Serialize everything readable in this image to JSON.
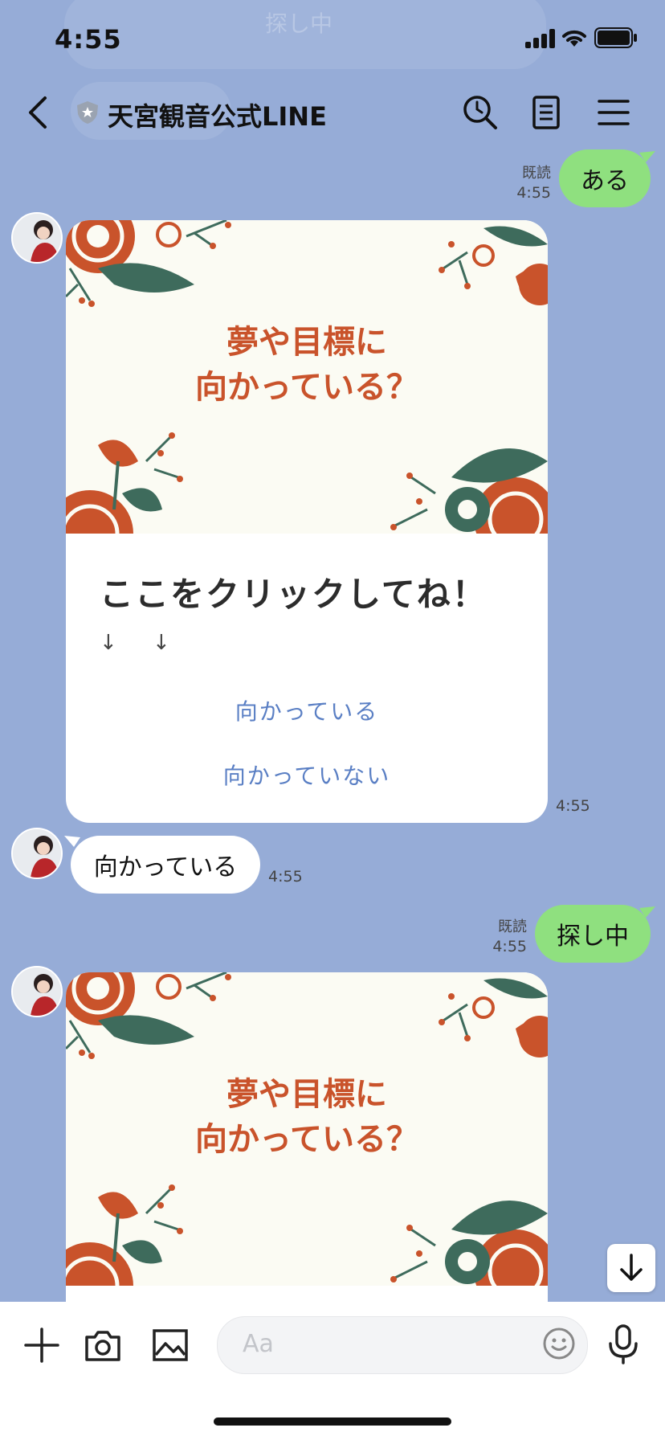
{
  "status_bar": {
    "time": "4:55"
  },
  "ghost_message": {
    "text": "探し中"
  },
  "header": {
    "title": "天宮観音公式LINE"
  },
  "messages": {
    "out1": {
      "read": "既読",
      "time": "4:55",
      "text": "ある"
    },
    "card1": {
      "image_line1": "夢や目標に",
      "image_line2": "向かっている？",
      "heading": "ここをクリックしてね！",
      "arrows": "↓ ↓",
      "option1": "向かっている",
      "option2": "向かっていない",
      "time": "4:55"
    },
    "in1": {
      "text": "向かっている",
      "time": "4:55"
    },
    "out2": {
      "read": "既読",
      "time": "4:55",
      "text": "探し中"
    },
    "card2": {
      "image_line1": "夢や目標に",
      "image_line2": "向かっている？"
    }
  },
  "input": {
    "placeholder": "Aa"
  },
  "colors": {
    "background": "#96acd7",
    "outgoing_bubble": "#8fe07f",
    "link": "#5a7fc4",
    "flower_red": "#c9532b",
    "leaf_green": "#3e6b5c"
  },
  "icons": [
    "back-icon",
    "shield-icon",
    "search-icon",
    "notes-icon",
    "menu-icon",
    "plus-icon",
    "camera-icon",
    "image-icon",
    "emoji-icon",
    "mic-icon",
    "arrow-down-icon"
  ]
}
